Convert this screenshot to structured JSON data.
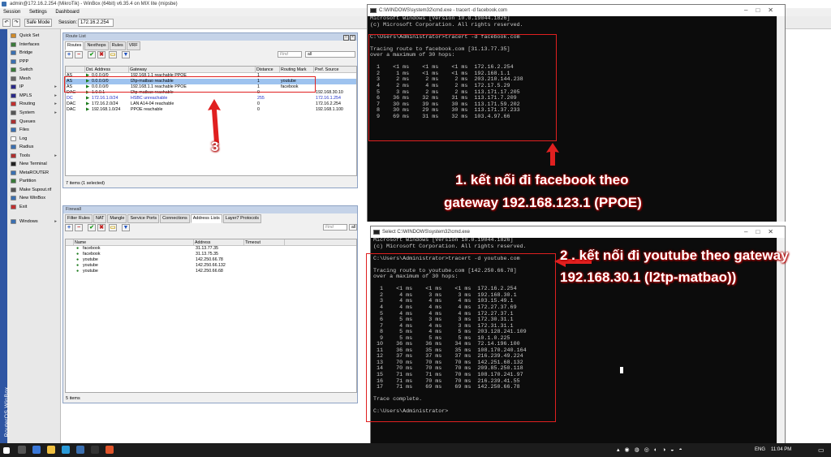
{
  "winbox": {
    "title": "admin@172.16.2.254 (MikroTik) - WinBox (64bit) v6.35.4 on MIX lite (mipsbe)",
    "menu": [
      "Session",
      "Settings",
      "Dashboard"
    ],
    "safe_mode": "Safe Mode",
    "session_label": "Session:",
    "session_value": "172.16.2.254",
    "vertical_label": "RouterOS WinBox"
  },
  "sidebar": {
    "items": [
      {
        "label": "Quick Set",
        "sub": false,
        "color": "#d08b2a"
      },
      {
        "label": "Interfaces",
        "sub": false,
        "color": "#3b7a3b"
      },
      {
        "label": "Bridge",
        "sub": false,
        "color": "#3b6fb0"
      },
      {
        "label": "PPP",
        "sub": false,
        "color": "#3b6fb0"
      },
      {
        "label": "Switch",
        "sub": false,
        "color": "#3b7a3b"
      },
      {
        "label": "Mesh",
        "sub": false,
        "color": "#666666"
      },
      {
        "label": "IP",
        "sub": true,
        "color": "#2a2a8a"
      },
      {
        "label": "MPLS",
        "sub": true,
        "color": "#2a2a8a"
      },
      {
        "label": "Routing",
        "sub": true,
        "color": "#c03030"
      },
      {
        "label": "System",
        "sub": true,
        "color": "#555555"
      },
      {
        "label": "Queues",
        "sub": false,
        "color": "#aa3030"
      },
      {
        "label": "Files",
        "sub": false,
        "color": "#3b6fb0"
      },
      {
        "label": "Log",
        "sub": false,
        "color": "#ffffff"
      },
      {
        "label": "Radius",
        "sub": false,
        "color": "#3b6fb0"
      },
      {
        "label": "Tools",
        "sub": true,
        "color": "#b03030"
      },
      {
        "label": "New Terminal",
        "sub": false,
        "color": "#222222"
      },
      {
        "label": "MetaROUTER",
        "sub": false,
        "color": "#3b6fb0"
      },
      {
        "label": "Partition",
        "sub": false,
        "color": "#3b7a3b"
      },
      {
        "label": "Make Supout.rif",
        "sub": false,
        "color": "#555555"
      },
      {
        "label": "New WinBox",
        "sub": false,
        "color": "#3b6fb0"
      },
      {
        "label": "Exit",
        "sub": false,
        "color": "#c03030"
      },
      {
        "label": "Windows",
        "sub": true,
        "color": "#3b6fb0"
      }
    ]
  },
  "routes_window": {
    "title": "Route List",
    "tabs": [
      "Routes",
      "Nexthops",
      "Rules",
      "VRF"
    ],
    "active_tab": 0,
    "find_placeholder": "Find",
    "filter_value": "all",
    "columns": [
      "",
      "Dst. Address",
      "Gateway",
      "Distance",
      "Routing Mark",
      "Pref. Source"
    ],
    "rows": [
      {
        "flag": "AS",
        "dst": "0.0.0.0/0",
        "gw": "192.168.1.1 reachable PPOE",
        "dist": "1",
        "mark": "",
        "pref": "",
        "sel": false,
        "blue": false
      },
      {
        "flag": "AS",
        "dst": "0.0.0.0/0",
        "gw": "l2tp-matbao reachable",
        "dist": "1",
        "mark": "youtube",
        "pref": "",
        "sel": true,
        "blue": false
      },
      {
        "flag": "AS",
        "dst": "0.0.0.0/0",
        "gw": "192.168.1.1 reachable PPOE",
        "dist": "1",
        "mark": "facebook",
        "pref": "",
        "sel": false,
        "blue": false
      },
      {
        "flag": "DAC",
        "dst": "1.0.0.1",
        "gw": "l2tp-matbao reachable",
        "dist": "0",
        "mark": "",
        "pref": "192.168.30.10",
        "sel": false,
        "blue": false
      },
      {
        "flag": "DC",
        "dst": "172.16.1.0/24",
        "gw": "HSBC unreachable",
        "dist": "255",
        "mark": "",
        "pref": "172.16.1.254",
        "sel": false,
        "blue": true
      },
      {
        "flag": "DAC",
        "dst": "172.16.2.0/24",
        "gw": "LAN A14-04 reachable",
        "dist": "0",
        "mark": "",
        "pref": "172.16.2.254",
        "sel": false,
        "blue": false
      },
      {
        "flag": "DAC",
        "dst": "192.168.1.0/24",
        "gw": "PPOE reachable",
        "dist": "0",
        "mark": "",
        "pref": "192.168.1.100",
        "sel": false,
        "blue": false
      }
    ],
    "status": "7 items (1 selected)"
  },
  "firewall_window": {
    "title": "Firewall",
    "tabs": [
      "Filter Rules",
      "NAT",
      "Mangle",
      "Service Ports",
      "Connections",
      "Address Lists",
      "Layer7 Protocols"
    ],
    "active_tab": 5,
    "find_placeholder": "Find",
    "filter_value": "all",
    "columns": [
      "Name",
      "Address",
      "Timeout"
    ],
    "rows": [
      {
        "name": "facebook",
        "address": "31.13.77.35"
      },
      {
        "name": "facebook",
        "address": "31.13.75.35"
      },
      {
        "name": "youtube",
        "address": "142.250.66.78"
      },
      {
        "name": "youtube",
        "address": "142.250.66.132"
      },
      {
        "name": "youtube",
        "address": "142.250.66.68"
      }
    ],
    "status": "5 items"
  },
  "cmd1": {
    "title": "C:\\WINDOWS\\system32\\cmd.exe - tracert -d facebook.com",
    "lines": [
      "Microsoft Windows [Version 10.0.19044.1826]",
      "(c) Microsoft Corporation. All rights reserved.",
      "",
      "C:\\Users\\Administrator>tracert -d facebook.com",
      "",
      "Tracing route to facebook.com [31.13.77.35]",
      "over a maximum of 30 hops:",
      "",
      "  1    <1 ms    <1 ms    <1 ms  172.16.2.254",
      "  2     1 ms    <1 ms    <1 ms  192.168.1.1",
      "  3     2 ms     2 ms     2 ms  203.210.144.238",
      "  4     2 ms     4 ms     2 ms  172.17.5.29",
      "  5     3 ms     2 ms     2 ms  113.171.17.205",
      "  6    36 ms    32 ms    31 ms  113.171.7.209",
      "  7    30 ms    39 ms    30 ms  113.171.59.202",
      "  8    30 ms    29 ms    30 ms  113.171.37.233",
      "  9    69 ms    31 ms    32 ms  103.4.97.66"
    ]
  },
  "cmd2": {
    "title": "Select C:\\WINDOWS\\system32\\cmd.exe",
    "lines": [
      "Microsoft Windows [Version 10.0.19044.1826]",
      "(c) Microsoft Corporation. All rights reserved.",
      "",
      "C:\\Users\\Administrator>tracert -d youtube.com",
      "",
      "Tracing route to youtube.com [142.250.66.78]",
      "over a maximum of 30 hops:",
      "",
      "  1    <1 ms    <1 ms    <1 ms  172.16.2.254",
      "  2     4 ms     3 ms     3 ms  192.168.30.1",
      "  3     4 ms     4 ms     4 ms  103.15.49.1",
      "  4     4 ms     4 ms     4 ms  172.27.37.69",
      "  5     4 ms     4 ms     4 ms  172.27.37.1",
      "  6     5 ms     3 ms     3 ms  172.30.31.1",
      "  7     4 ms     4 ms     3 ms  172.31.31.1",
      "  8     5 ms     4 ms     5 ms  203.128.241.109",
      "  9     5 ms     5 ms     5 ms  10.1.0.225",
      " 10    36 ms    36 ms    34 ms  72.14.196.100",
      " 11    36 ms    35 ms    35 ms  108.170.240.164",
      " 12    37 ms    37 ms    37 ms  216.239.49.224",
      " 13    70 ms    70 ms    70 ms  142.251.68.132",
      " 14    70 ms    70 ms    70 ms  209.85.250.118",
      " 15    71 ms    71 ms    70 ms  108.170.241.97",
      " 16    71 ms    70 ms    70 ms  216.239.41.55",
      " 17    71 ms    69 ms    69 ms  142.250.66.78",
      "",
      "Trace complete.",
      "",
      "C:\\Users\\Administrator>"
    ]
  },
  "annotations": {
    "a1_line1": "1. kết nối đi facebook theo",
    "a1_line2": "gateway 192.168.123.1 (PPOE)",
    "a2_line1": "2 . kết nối đi youtube theo gateway",
    "a2_line2": "192.168.30.1 (l2tp-matbao))",
    "a3": "3"
  },
  "taskbar": {
    "lang": "ENG",
    "time": "11:04 PM"
  },
  "colors": {
    "winbox_strip": "#2f56a3",
    "annotation_red": "#e02020",
    "cmd_bg": "#0c0c0c",
    "selected_row": "#9ec3ef"
  }
}
